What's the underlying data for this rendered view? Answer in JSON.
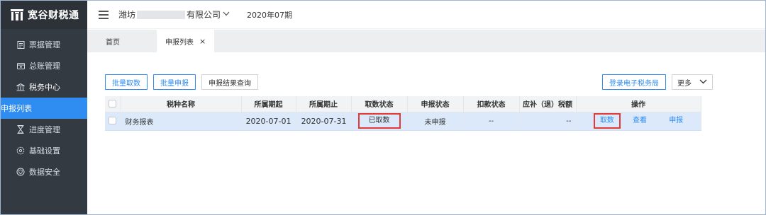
{
  "brand": {
    "name": "宽谷财税通"
  },
  "sidebar": {
    "items": [
      {
        "label": "票据管理",
        "icon": "receipt-icon"
      },
      {
        "label": "总账管理",
        "icon": "ledger-icon"
      },
      {
        "label": "税务中心",
        "icon": "tax-office-icon"
      },
      {
        "label": "申报列表",
        "icon": "",
        "active": true
      },
      {
        "label": "进度管理",
        "icon": "hourglass-icon"
      },
      {
        "label": "基础设置",
        "icon": "gear-icon"
      },
      {
        "label": "数据安全",
        "icon": "shield-icon"
      }
    ]
  },
  "header": {
    "company_prefix": "潍坊",
    "company_suffix": "有限公司",
    "period": "2020年07期"
  },
  "tabs": {
    "home": "首页",
    "active": "申报列表",
    "close": "×"
  },
  "toolbar": {
    "batch_fetch": "批量取数",
    "batch_declare": "批量申报",
    "declare_result_query": "申报结果查询",
    "login_e_tax": "登录电子税务局",
    "more": "更多"
  },
  "table": {
    "headers": [
      "税种名称",
      "所属期起",
      "所属期止",
      "取数状态",
      "申报状态",
      "扣款状态",
      "应补（退）税额",
      "操作"
    ],
    "rows": [
      {
        "tax_name": "财务报表",
        "period_start": "2020-07-01",
        "period_end": "2020-07-31",
        "fetch_status": "已取数",
        "declare_status": "未申报",
        "deduct_status": "--",
        "amount": "--",
        "actions": [
          "取数",
          "查看",
          "申报"
        ]
      }
    ]
  },
  "colors": {
    "sidebar_bg": "#333a41",
    "accent": "#2f8cf0",
    "row_highlight": "#dbe9fb",
    "highlight_box": "#e53935"
  }
}
